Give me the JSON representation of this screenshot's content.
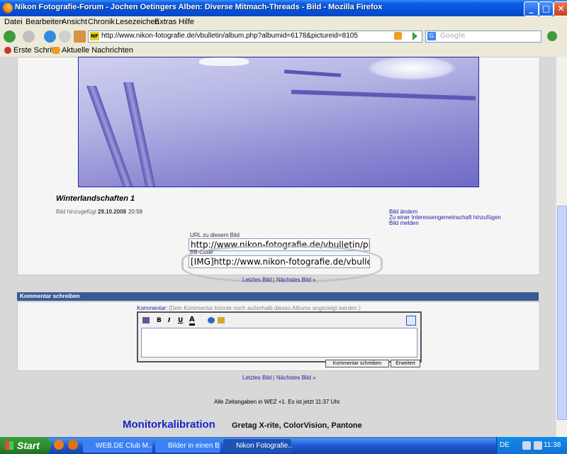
{
  "window": {
    "title": "Nikon Fotografie-Forum - Jochen Oetingers Alben: Diverse Mitmach-Threads - Bild - Mozilla Firefox",
    "buttons": {
      "minimize": "_",
      "maximize": "□",
      "close": "✕"
    }
  },
  "menu": [
    "Datei",
    "Bearbeiten",
    "Ansicht",
    "Chronik",
    "Lesezeichen",
    "Extras",
    "Hilfe"
  ],
  "nav": {
    "url": "http://www.nikon-fotografie.de/vbulletin/album.php?albumid=6178&pictureid=8105",
    "url_badge": "NF",
    "search_placeholder": "Google"
  },
  "bookmarks": [
    "Erste Schritte",
    "Aktuelle Nachrichten"
  ],
  "picture": {
    "title": "Winterlandschaften 1",
    "added_label": "Bild hinzugefügt",
    "added_date": "29.10.2008",
    "added_time": "20:58",
    "actions": [
      "Bild ändern",
      "Zu einer Interessengemeinschaft hinzufügen",
      "Bild melden"
    ],
    "url_label": "URL zu diesem Bild",
    "url_value": "http://www.nikon-fotografie.de/vbulletin/pictu",
    "bbcode_label": "BB-Code",
    "bbcode_value": "[IMG]http://www.nikon-fotografie.de/vbulletin",
    "nav_prev": "Letztes Bild",
    "nav_sep": "|",
    "nav_next": "Nächstes Bild »"
  },
  "comment": {
    "header": "Kommentar schreiben",
    "label": "Kommentar:",
    "hint": "(Dein Kommentar könnte noch außerhalb dieses Albums angezeigt werden.)",
    "toolbar": [
      "B",
      "I",
      "U",
      "A"
    ],
    "submit": "Kommentar schreiben",
    "advanced": "Erweitert"
  },
  "footer": {
    "timezone": "Alle Zeitangaben in WEZ +1. Es ist jetzt 11:37 Uhr.",
    "ad_title": "Monitorkalibration",
    "ad_sub": "Gretag X-rite, ColorVision, Pantone"
  },
  "taskbar": {
    "start": "Start",
    "tasks": [
      "WEB.DE Club M...",
      "Bilder in einen B...",
      "Nikon Fotografie..."
    ],
    "lang": "DE",
    "clock": "11:38"
  }
}
